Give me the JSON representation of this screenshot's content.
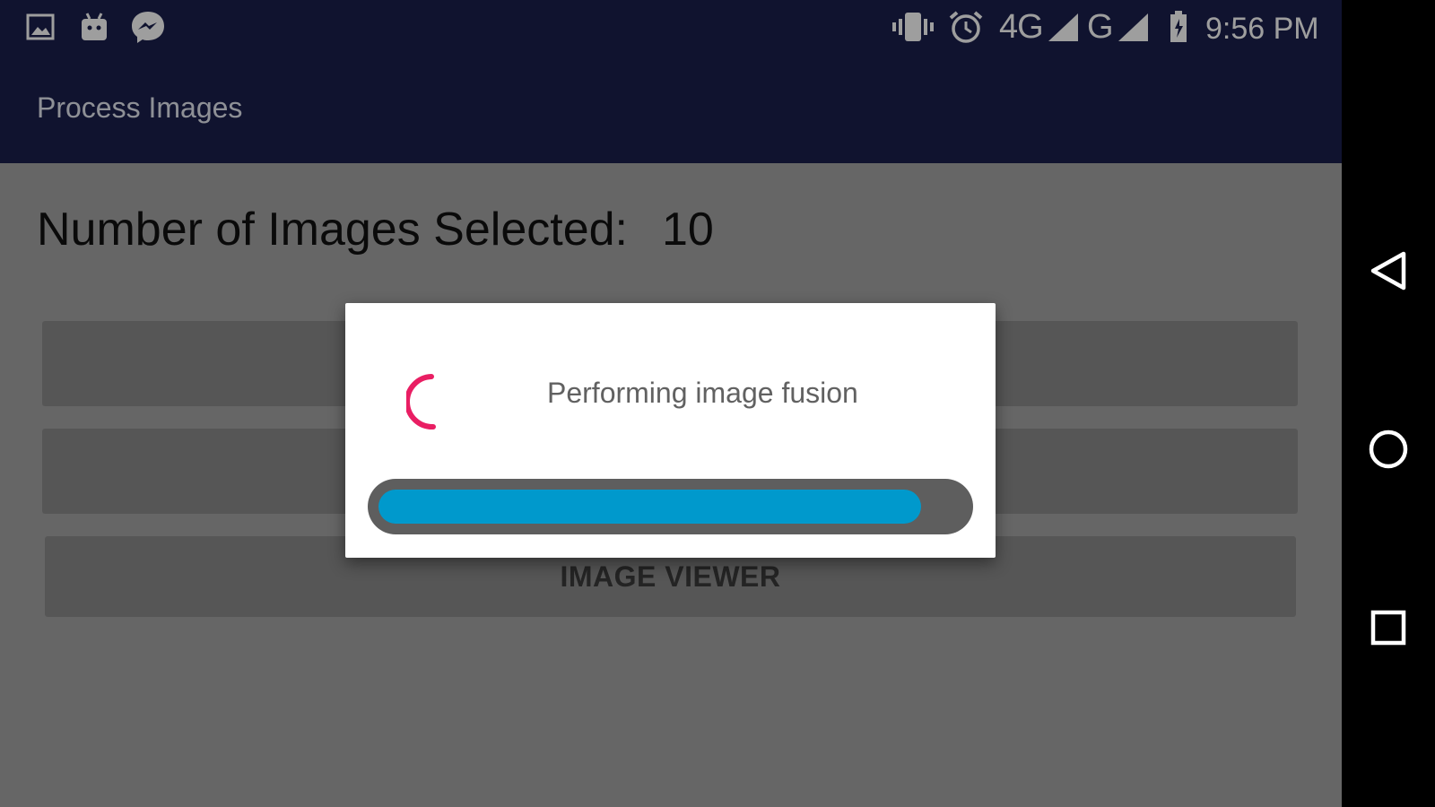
{
  "status_bar": {
    "left_icons": [
      "image-icon",
      "android-icon",
      "messenger-icon"
    ],
    "right_icons": [
      "vibrate-icon",
      "alarm-icon",
      "signal-icon",
      "battery-icon"
    ],
    "network_1": "4G",
    "network_2": "G",
    "time": "9:56 PM"
  },
  "app_bar": {
    "title": "Process Images"
  },
  "content": {
    "count_label": "Number of Images Selected:",
    "count_value": "10",
    "buttons": [
      "",
      "",
      "IMAGE VIEWER"
    ]
  },
  "dialog": {
    "message": "Performing image fusion",
    "progress": 0.93,
    "spinner_color": "#e91e63",
    "progress_color": "#0099cc"
  },
  "nav_bar": {
    "icons": [
      "back-icon",
      "home-icon",
      "recents-icon"
    ]
  }
}
